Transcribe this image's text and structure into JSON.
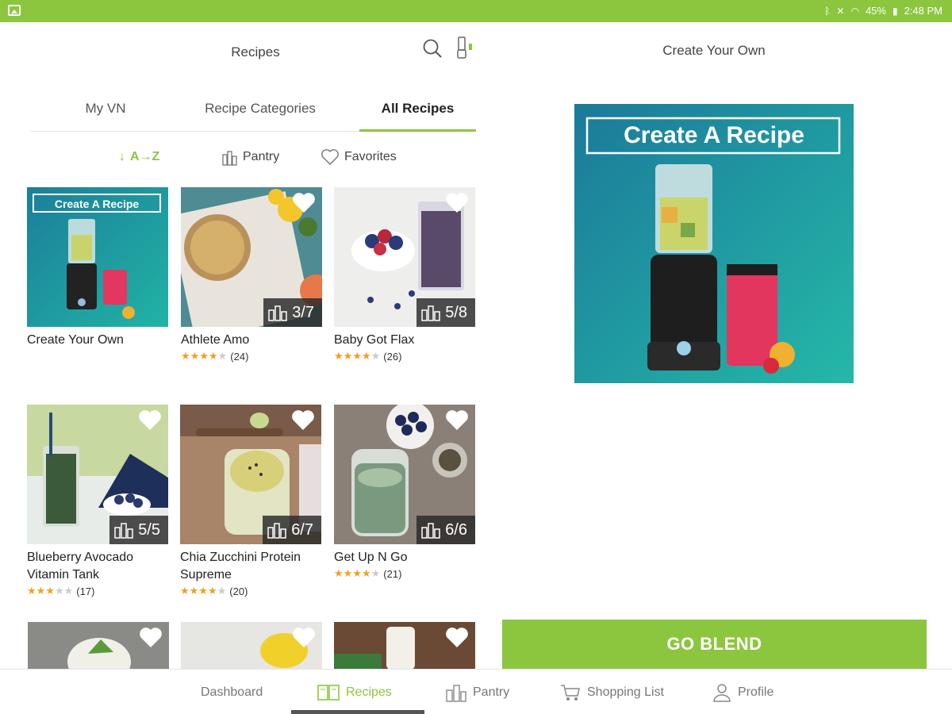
{
  "status_bar": {
    "battery": "45%",
    "time": "2:48 PM"
  },
  "header": {
    "title": "Recipes"
  },
  "tabs": [
    {
      "label": "My VN",
      "active": false
    },
    {
      "label": "Recipe Categories",
      "active": false
    },
    {
      "label": "All Recipes",
      "active": true
    }
  ],
  "filters": {
    "sort_label": "A→Z",
    "pantry_label": "Pantry",
    "favorites_label": "Favorites"
  },
  "recipes": [
    {
      "title": "Create Your Own",
      "banner": "Create A Recipe"
    },
    {
      "title": "Athlete Amo",
      "pantry": "3/7",
      "stars": 4,
      "reviews": "(24)"
    },
    {
      "title": "Baby Got Flax",
      "pantry": "5/8",
      "stars": 4,
      "reviews": "(26)"
    },
    {
      "title": "Blueberry Avocado Vitamin Tank",
      "pantry": "5/5",
      "stars": 3,
      "reviews": "(17)"
    },
    {
      "title": "Chia Zucchini Protein Supreme",
      "pantry": "6/7",
      "stars": 4,
      "reviews": "(20)"
    },
    {
      "title": "Get Up N Go",
      "pantry": "6/6",
      "stars": 4,
      "reviews": "(21)"
    }
  ],
  "right_panel": {
    "title": "Create Your Own",
    "promo_text": "Create A Recipe",
    "action_label": "GO BLEND"
  },
  "bottom_nav": [
    {
      "label": "Dashboard",
      "icon": "dashboard-icon",
      "active": false
    },
    {
      "label": "Recipes",
      "icon": "book-icon",
      "active": true
    },
    {
      "label": "Pantry",
      "icon": "pantry-icon",
      "active": false
    },
    {
      "label": "Shopping List",
      "icon": "cart-icon",
      "active": false
    },
    {
      "label": "Profile",
      "icon": "person-icon",
      "active": false
    }
  ],
  "colors": {
    "accent": "#8cc63f",
    "star": "#f0a020",
    "promo_bg": "#1f8fa0"
  }
}
